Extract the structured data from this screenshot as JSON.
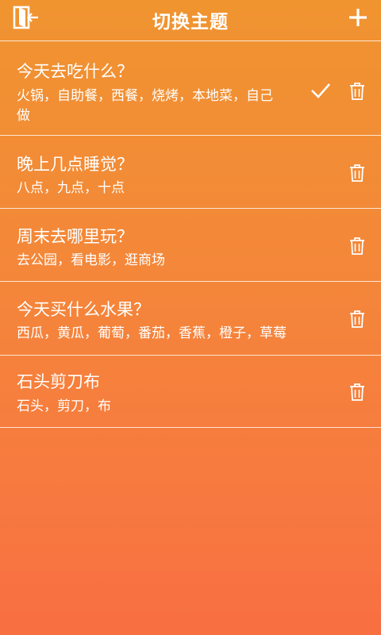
{
  "header": {
    "title": "切换主题",
    "back_icon": "exit-door-icon",
    "add_icon": "plus-icon"
  },
  "themes": [
    {
      "question": "今天去吃什么？",
      "options": "火锅，自助餐，西餐，烧烤，本地菜，自己做",
      "selected": true
    },
    {
      "question": "晚上几点睡觉？",
      "options": "八点，九点，十点",
      "selected": false
    },
    {
      "question": "周末去哪里玩？",
      "options": "去公园，看电影，逛商场",
      "selected": false
    },
    {
      "question": "今天买什么水果？",
      "options": "西瓜，黄瓜，葡萄，番茄，香蕉，橙子，草莓",
      "selected": false
    },
    {
      "question": "石头剪刀布",
      "options": "石头，剪刀，布",
      "selected": false
    }
  ],
  "icons": {
    "selected": "check-icon",
    "delete": "trash-icon"
  },
  "colors": {
    "gradient_top": "#f09430",
    "gradient_bottom": "#f86f42",
    "text": "#ffffff"
  }
}
